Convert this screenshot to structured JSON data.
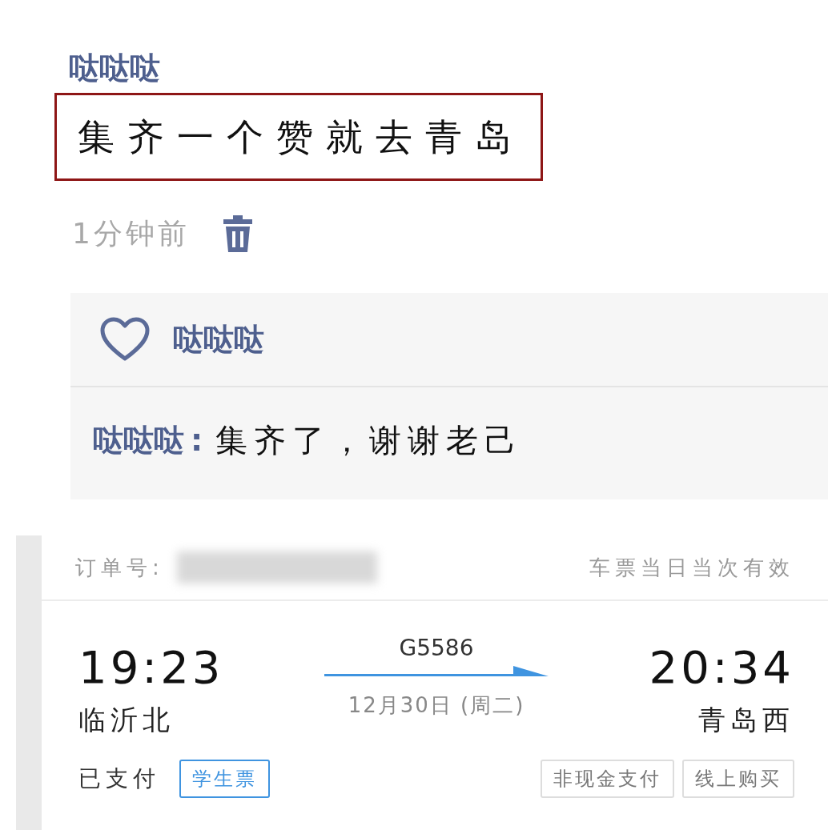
{
  "post": {
    "author": "哒哒哒",
    "text": "集齐一个赞就去青岛",
    "highlighted": true,
    "time": "1分钟前"
  },
  "likes": [
    {
      "name": "哒哒哒"
    }
  ],
  "comments": [
    {
      "author": "哒哒哒",
      "separator": ":",
      "text": "集齐了，谢谢老己"
    }
  ],
  "ticket": {
    "order_label": "订单号:",
    "validity": "车票当日当次有效",
    "departure": {
      "time": "19:23",
      "station": "临沂北"
    },
    "train": "G5586",
    "date": "12月30日 (周二)",
    "arrival": {
      "time": "20:34",
      "station": "青岛西"
    },
    "payment_status": "已支付",
    "ticket_type": "学生票",
    "tags": [
      "非现金支付",
      "线上购买"
    ]
  }
}
